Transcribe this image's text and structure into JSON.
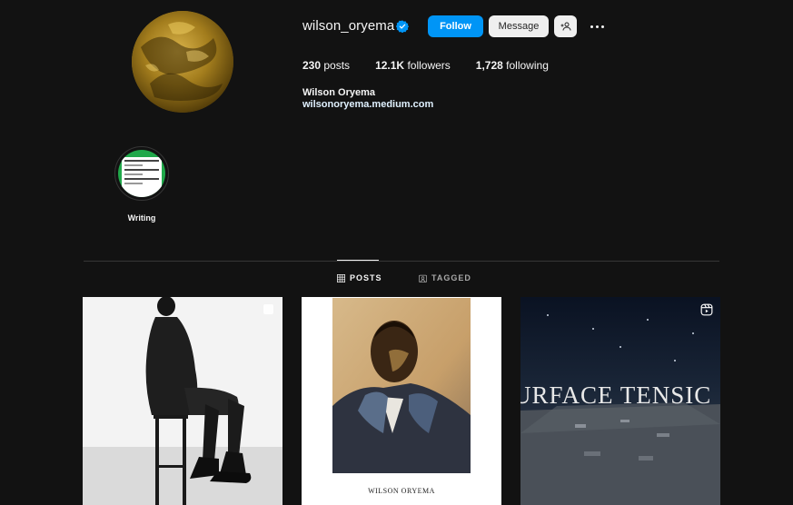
{
  "profile": {
    "username": "wilson_oryema",
    "full_name": "Wilson Oryema",
    "website": "wilsonoryema.medium.com",
    "verified": true
  },
  "actions": {
    "follow_label": "Follow",
    "message_label": "Message",
    "add_user_icon": "add-user-icon",
    "more_icon": "more-options-icon"
  },
  "stats": {
    "posts_count": "230",
    "posts_label": "posts",
    "followers_count": "12.1K",
    "followers_label": "followers",
    "following_count": "1,728",
    "following_label": "following"
  },
  "highlights": [
    {
      "label": "Writing"
    }
  ],
  "tabs": [
    {
      "label": "POSTS",
      "icon": "grid-icon",
      "active": true
    },
    {
      "label": "TAGGED",
      "icon": "tagged-icon",
      "active": false
    }
  ],
  "posts": [
    {
      "type": "image",
      "overlay_icon": "multi-image-icon"
    },
    {
      "type": "image",
      "caption": "WILSON ORYEMA"
    },
    {
      "type": "reel",
      "overlay_icon": "reels-icon",
      "caption": "URFACE TENSIC"
    }
  ],
  "colors": {
    "background": "#121212",
    "follow_button": "#0095f6",
    "secondary_button": "#efefef",
    "verified_badge": "#0095f6",
    "divider": "#363636"
  }
}
